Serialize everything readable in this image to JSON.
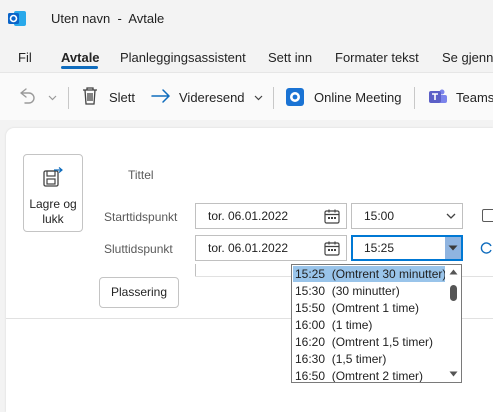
{
  "window": {
    "title": "Uten navn  -  Avtale"
  },
  "menu": {
    "tabs": [
      {
        "label": "Fil"
      },
      {
        "label": "Avtale"
      },
      {
        "label": "Planleggingsassistent"
      },
      {
        "label": "Sett inn"
      },
      {
        "label": "Formater tekst"
      },
      {
        "label": "Se gjenn"
      }
    ],
    "active_tab": "Avtale"
  },
  "ribbon": {
    "delete_label": "Slett",
    "forward_label": "Videresend",
    "meeting_label": "Online Meeting",
    "teams_label": "Teams"
  },
  "form": {
    "save_close_label": "Lagre og lukk",
    "title_label": "Tittel",
    "start_label": "Starttidspunkt",
    "end_label": "Sluttidspunkt",
    "start_date": "tor. 06.01.2022",
    "start_time": "15:00",
    "end_date": "tor. 06.01.2022",
    "end_time": "15:25",
    "location_label": "Plassering"
  },
  "time_dropdown": {
    "items": [
      "15:25  (Omtrent 30 minutter)",
      "15:30  (30 minutter)",
      "15:50  (Omtrent 1 time)",
      "16:00  (1 time)",
      "16:20  (Omtrent 1,5 timer)",
      "16:30  (1,5 timer)",
      "16:50  (Omtrent 2 timer)"
    ],
    "selected_index": 0
  },
  "colors": {
    "accent": "#0f6cbd",
    "selection": "#99c4ea",
    "teams": "#5b5fc7",
    "outlook": "#0a64c8"
  },
  "icons": [
    "outlook-icon",
    "undo-icon",
    "trash-icon",
    "forward-arrow-icon",
    "teams-meeting-icon",
    "teams-icon",
    "save-icon",
    "calendar-icon"
  ]
}
